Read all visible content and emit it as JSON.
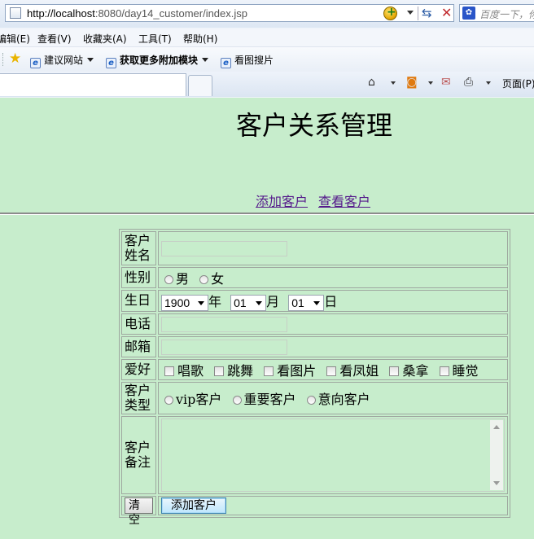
{
  "browser": {
    "url_host": "http://localhost",
    "url_path": ":8080/day14_customer/index.jsp",
    "search_placeholder": "百度一下，你",
    "menu": [
      "编辑(E)",
      "查看(V)",
      "收藏夹(A)",
      "工具(T)",
      "帮助(H)"
    ],
    "favorites": [
      "建议网站",
      "获取更多附加模块",
      "看图搜片"
    ],
    "page_menu": "页面(P)"
  },
  "page": {
    "title": "客户关系管理",
    "nav": {
      "add": "添加客户",
      "view": "查看客户"
    }
  },
  "form": {
    "labels": {
      "name": "客户姓名",
      "gender": "性别",
      "birthday": "生日",
      "phone": "电话",
      "email": "邮箱",
      "hobby": "爱好",
      "type": "客户类型",
      "notes": "客户备注"
    },
    "values": {
      "name": "",
      "phone": "",
      "email": "",
      "notes": ""
    },
    "gender_options": [
      "男",
      "女"
    ],
    "birthday": {
      "year": "1900",
      "month": "01",
      "day": "01",
      "year_unit": "年",
      "month_unit": "月",
      "day_unit": "日"
    },
    "hobbies": [
      "唱歌",
      "跳舞",
      "看图片",
      "看凤姐",
      "桑拿",
      "睡觉"
    ],
    "types": [
      "vip客户",
      "重要客户",
      "意向客户"
    ],
    "buttons": {
      "reset": "清空",
      "submit": "添加客户"
    }
  }
}
